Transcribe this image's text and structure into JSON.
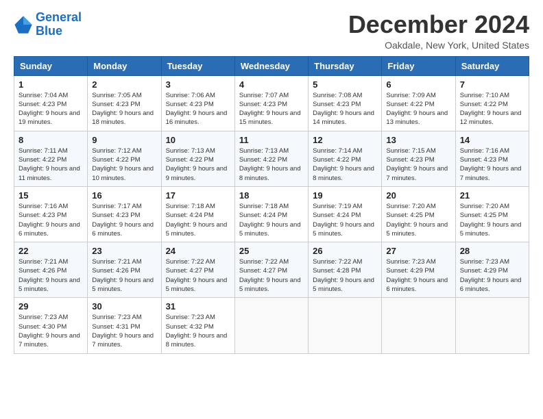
{
  "header": {
    "logo_line1": "General",
    "logo_line2": "Blue",
    "month_title": "December 2024",
    "location": "Oakdale, New York, United States"
  },
  "days_of_week": [
    "Sunday",
    "Monday",
    "Tuesday",
    "Wednesday",
    "Thursday",
    "Friday",
    "Saturday"
  ],
  "weeks": [
    [
      {
        "day": "1",
        "sunrise": "Sunrise: 7:04 AM",
        "sunset": "Sunset: 4:23 PM",
        "daylight": "Daylight: 9 hours and 19 minutes."
      },
      {
        "day": "2",
        "sunrise": "Sunrise: 7:05 AM",
        "sunset": "Sunset: 4:23 PM",
        "daylight": "Daylight: 9 hours and 18 minutes."
      },
      {
        "day": "3",
        "sunrise": "Sunrise: 7:06 AM",
        "sunset": "Sunset: 4:23 PM",
        "daylight": "Daylight: 9 hours and 16 minutes."
      },
      {
        "day": "4",
        "sunrise": "Sunrise: 7:07 AM",
        "sunset": "Sunset: 4:23 PM",
        "daylight": "Daylight: 9 hours and 15 minutes."
      },
      {
        "day": "5",
        "sunrise": "Sunrise: 7:08 AM",
        "sunset": "Sunset: 4:23 PM",
        "daylight": "Daylight: 9 hours and 14 minutes."
      },
      {
        "day": "6",
        "sunrise": "Sunrise: 7:09 AM",
        "sunset": "Sunset: 4:22 PM",
        "daylight": "Daylight: 9 hours and 13 minutes."
      },
      {
        "day": "7",
        "sunrise": "Sunrise: 7:10 AM",
        "sunset": "Sunset: 4:22 PM",
        "daylight": "Daylight: 9 hours and 12 minutes."
      }
    ],
    [
      {
        "day": "8",
        "sunrise": "Sunrise: 7:11 AM",
        "sunset": "Sunset: 4:22 PM",
        "daylight": "Daylight: 9 hours and 11 minutes."
      },
      {
        "day": "9",
        "sunrise": "Sunrise: 7:12 AM",
        "sunset": "Sunset: 4:22 PM",
        "daylight": "Daylight: 9 hours and 10 minutes."
      },
      {
        "day": "10",
        "sunrise": "Sunrise: 7:13 AM",
        "sunset": "Sunset: 4:22 PM",
        "daylight": "Daylight: 9 hours and 9 minutes."
      },
      {
        "day": "11",
        "sunrise": "Sunrise: 7:13 AM",
        "sunset": "Sunset: 4:22 PM",
        "daylight": "Daylight: 9 hours and 8 minutes."
      },
      {
        "day": "12",
        "sunrise": "Sunrise: 7:14 AM",
        "sunset": "Sunset: 4:22 PM",
        "daylight": "Daylight: 9 hours and 8 minutes."
      },
      {
        "day": "13",
        "sunrise": "Sunrise: 7:15 AM",
        "sunset": "Sunset: 4:23 PM",
        "daylight": "Daylight: 9 hours and 7 minutes."
      },
      {
        "day": "14",
        "sunrise": "Sunrise: 7:16 AM",
        "sunset": "Sunset: 4:23 PM",
        "daylight": "Daylight: 9 hours and 7 minutes."
      }
    ],
    [
      {
        "day": "15",
        "sunrise": "Sunrise: 7:16 AM",
        "sunset": "Sunset: 4:23 PM",
        "daylight": "Daylight: 9 hours and 6 minutes."
      },
      {
        "day": "16",
        "sunrise": "Sunrise: 7:17 AM",
        "sunset": "Sunset: 4:23 PM",
        "daylight": "Daylight: 9 hours and 6 minutes."
      },
      {
        "day": "17",
        "sunrise": "Sunrise: 7:18 AM",
        "sunset": "Sunset: 4:24 PM",
        "daylight": "Daylight: 9 hours and 5 minutes."
      },
      {
        "day": "18",
        "sunrise": "Sunrise: 7:18 AM",
        "sunset": "Sunset: 4:24 PM",
        "daylight": "Daylight: 9 hours and 5 minutes."
      },
      {
        "day": "19",
        "sunrise": "Sunrise: 7:19 AM",
        "sunset": "Sunset: 4:24 PM",
        "daylight": "Daylight: 9 hours and 5 minutes."
      },
      {
        "day": "20",
        "sunrise": "Sunrise: 7:20 AM",
        "sunset": "Sunset: 4:25 PM",
        "daylight": "Daylight: 9 hours and 5 minutes."
      },
      {
        "day": "21",
        "sunrise": "Sunrise: 7:20 AM",
        "sunset": "Sunset: 4:25 PM",
        "daylight": "Daylight: 9 hours and 5 minutes."
      }
    ],
    [
      {
        "day": "22",
        "sunrise": "Sunrise: 7:21 AM",
        "sunset": "Sunset: 4:26 PM",
        "daylight": "Daylight: 9 hours and 5 minutes."
      },
      {
        "day": "23",
        "sunrise": "Sunrise: 7:21 AM",
        "sunset": "Sunset: 4:26 PM",
        "daylight": "Daylight: 9 hours and 5 minutes."
      },
      {
        "day": "24",
        "sunrise": "Sunrise: 7:22 AM",
        "sunset": "Sunset: 4:27 PM",
        "daylight": "Daylight: 9 hours and 5 minutes."
      },
      {
        "day": "25",
        "sunrise": "Sunrise: 7:22 AM",
        "sunset": "Sunset: 4:27 PM",
        "daylight": "Daylight: 9 hours and 5 minutes."
      },
      {
        "day": "26",
        "sunrise": "Sunrise: 7:22 AM",
        "sunset": "Sunset: 4:28 PM",
        "daylight": "Daylight: 9 hours and 5 minutes."
      },
      {
        "day": "27",
        "sunrise": "Sunrise: 7:23 AM",
        "sunset": "Sunset: 4:29 PM",
        "daylight": "Daylight: 9 hours and 6 minutes."
      },
      {
        "day": "28",
        "sunrise": "Sunrise: 7:23 AM",
        "sunset": "Sunset: 4:29 PM",
        "daylight": "Daylight: 9 hours and 6 minutes."
      }
    ],
    [
      {
        "day": "29",
        "sunrise": "Sunrise: 7:23 AM",
        "sunset": "Sunset: 4:30 PM",
        "daylight": "Daylight: 9 hours and 7 minutes."
      },
      {
        "day": "30",
        "sunrise": "Sunrise: 7:23 AM",
        "sunset": "Sunset: 4:31 PM",
        "daylight": "Daylight: 9 hours and 7 minutes."
      },
      {
        "day": "31",
        "sunrise": "Sunrise: 7:23 AM",
        "sunset": "Sunset: 4:32 PM",
        "daylight": "Daylight: 9 hours and 8 minutes."
      },
      null,
      null,
      null,
      null
    ]
  ]
}
